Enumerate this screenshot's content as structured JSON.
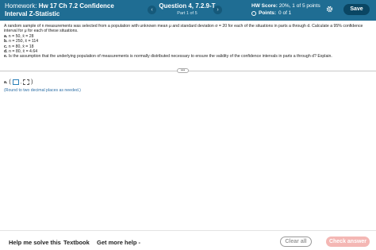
{
  "header": {
    "homework_label": "Homework:",
    "homework_name": "Hw 17 Ch 7.2 Confidence",
    "homework_name_line2": "Interval Z-Statistic",
    "prev_icon": "chevron-left-icon",
    "next_icon": "chevron-right-icon",
    "question_title": "Question 4, 7.2.9-T",
    "question_part": "Part 1 of 5",
    "hw_score_label": "HW Score:",
    "hw_score_value": "20%, 1 of 5 points",
    "points_label": "Points:",
    "points_value": "0 of 1",
    "settings_icon": "gear-icon",
    "save_label": "Save",
    "colors": {
      "bar": "#1f6d93",
      "save": "#0a4663"
    }
  },
  "question": {
    "intro": "A random sample of n measurements was selected from a population with unknown mean μ and standard deviation σ = 20 for each of the situations in parts a through d. Calculate a 95% confidence interval for μ for each of these situations.",
    "items": [
      {
        "label": "a.",
        "text": "n = 50, x̄ = 28"
      },
      {
        "label": "b.",
        "text": "n = 250, x̄ = 114"
      },
      {
        "label": "c.",
        "text": "n = 80, x̄ = 18"
      },
      {
        "label": "d.",
        "text": "n = 80, x̄ = 4.64"
      },
      {
        "label": "e.",
        "text": "Is the assumption that the underlying population of measurements is normally distributed necessary to ensure the validity of the confidence intervals in parts a through d? Explain."
      }
    ]
  },
  "divider_handle": "•••",
  "answer": {
    "label": "a.",
    "open_paren": "(",
    "separator": ",",
    "close_paren": ")",
    "note": "(Round to two decimal places as needed.)"
  },
  "footer": {
    "help_label": "Help me solve this",
    "textbook_label": "Textbook",
    "more_help_label": "Get more help -",
    "clear_label": "Clear all",
    "check_label": "Check answer",
    "colors": {
      "check": "#f4b7b4"
    }
  }
}
